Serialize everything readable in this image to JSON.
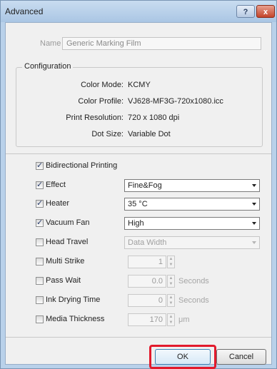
{
  "window": {
    "title": "Advanced",
    "help_label": "?",
    "close_label": "x"
  },
  "name": {
    "label": "Name",
    "value": "Generic Marking Film"
  },
  "configuration": {
    "title": "Configuration",
    "rows": [
      {
        "key": "Color Mode:",
        "value": "KCMY"
      },
      {
        "key": "Color Profile:",
        "value": "VJ628-MF3G-720x1080.icc"
      },
      {
        "key": "Print Resolution:",
        "value": "720 x 1080 dpi"
      },
      {
        "key": "Dot Size:",
        "value": "Variable Dot"
      }
    ]
  },
  "options": {
    "bidirectional": {
      "label": "Bidirectional Printing",
      "checked": true
    },
    "effect": {
      "label": "Effect",
      "checked": true,
      "value": "Fine&Fog"
    },
    "heater": {
      "label": "Heater",
      "checked": true,
      "value": "35 °C"
    },
    "vacuum": {
      "label": "Vacuum Fan",
      "checked": true,
      "value": "High"
    },
    "head_travel": {
      "label": "Head Travel",
      "checked": false,
      "value": "Data Width"
    },
    "multi_strike": {
      "label": "Multi Strike",
      "checked": false,
      "value": "1",
      "unit": ""
    },
    "pass_wait": {
      "label": "Pass Wait",
      "checked": false,
      "value": "0.0",
      "unit": "Seconds"
    },
    "ink_drying": {
      "label": "Ink Drying Time",
      "checked": false,
      "value": "0",
      "unit": "Seconds"
    },
    "media_thickness": {
      "label": "Media Thickness",
      "checked": false,
      "value": "170",
      "unit": "μm"
    }
  },
  "buttons": {
    "ok": "OK",
    "cancel": "Cancel"
  },
  "colors": {
    "highlight": "#e21a2c"
  }
}
